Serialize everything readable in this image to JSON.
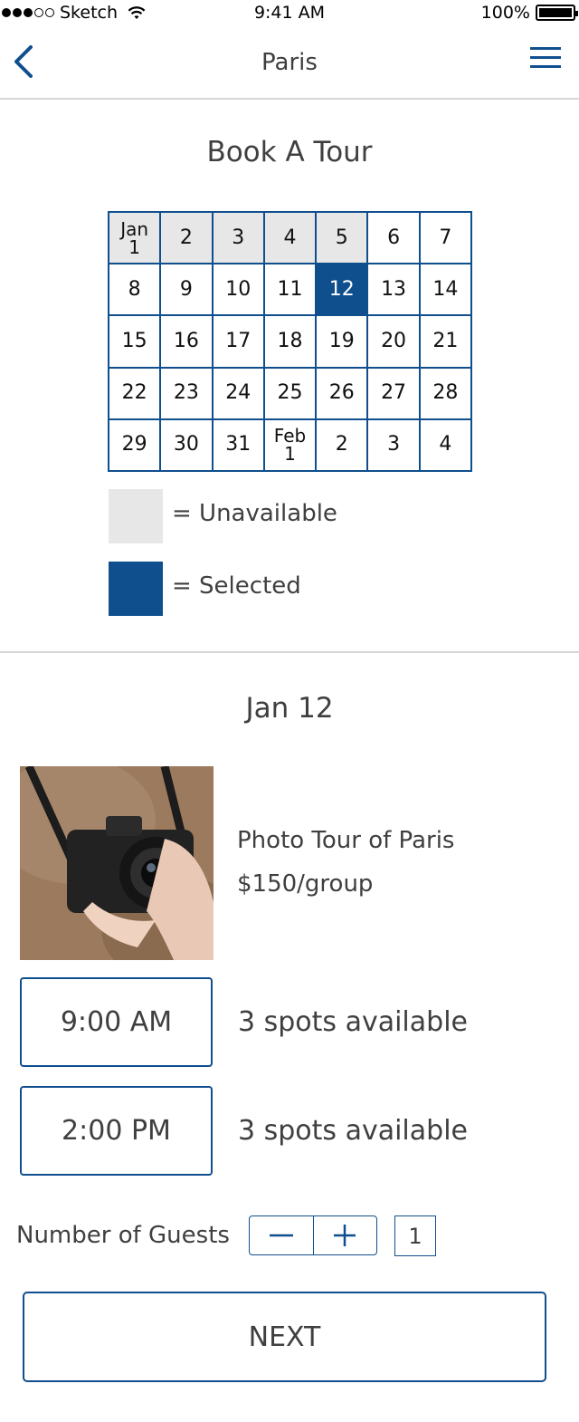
{
  "status_bar": {
    "carrier": "Sketch",
    "time": "9:41 AM",
    "battery": "100%",
    "signal_bars": 3
  },
  "nav": {
    "title": "Paris",
    "back_icon": "chevron-left-icon",
    "menu_icon": "hamburger-menu-icon"
  },
  "booking": {
    "heading": "Book A Tour"
  },
  "calendar": {
    "selected": "12",
    "rows": [
      [
        {
          "label": "Jan\n1",
          "state": "unavailable"
        },
        {
          "label": "2",
          "state": "unavailable"
        },
        {
          "label": "3",
          "state": "unavailable"
        },
        {
          "label": "4",
          "state": "unavailable"
        },
        {
          "label": "5",
          "state": "unavailable"
        },
        {
          "label": "6",
          "state": "available"
        },
        {
          "label": "7",
          "state": "available"
        }
      ],
      [
        {
          "label": "8",
          "state": "available"
        },
        {
          "label": "9",
          "state": "available"
        },
        {
          "label": "10",
          "state": "available"
        },
        {
          "label": "11",
          "state": "available"
        },
        {
          "label": "12",
          "state": "selected"
        },
        {
          "label": "13",
          "state": "available"
        },
        {
          "label": "14",
          "state": "available"
        }
      ],
      [
        {
          "label": "15",
          "state": "available"
        },
        {
          "label": "16",
          "state": "available"
        },
        {
          "label": "17",
          "state": "available"
        },
        {
          "label": "18",
          "state": "available"
        },
        {
          "label": "19",
          "state": "available"
        },
        {
          "label": "20",
          "state": "available"
        },
        {
          "label": "21",
          "state": "available"
        }
      ],
      [
        {
          "label": "22",
          "state": "available"
        },
        {
          "label": "23",
          "state": "available"
        },
        {
          "label": "24",
          "state": "available"
        },
        {
          "label": "25",
          "state": "available"
        },
        {
          "label": "26",
          "state": "available"
        },
        {
          "label": "27",
          "state": "available"
        },
        {
          "label": "28",
          "state": "available"
        }
      ],
      [
        {
          "label": "29",
          "state": "available"
        },
        {
          "label": "30",
          "state": "available"
        },
        {
          "label": "31",
          "state": "available"
        },
        {
          "label": "Feb\n1",
          "state": "available"
        },
        {
          "label": "2",
          "state": "available"
        },
        {
          "label": "3",
          "state": "available"
        },
        {
          "label": "4",
          "state": "available"
        }
      ]
    ]
  },
  "legend": {
    "unavailable": "= Unavailable",
    "selected": "= Selected"
  },
  "colors": {
    "accent": "#104f8e",
    "unavailable": "#e7e7e7",
    "text": "#3f3f3f",
    "divider": "#d6d6d6"
  },
  "day": {
    "date_label": "Jan 12"
  },
  "tour": {
    "name": "Photo Tour of Paris",
    "price": "$150/group",
    "image": "camera-photo"
  },
  "slots": [
    {
      "time": "9:00 AM",
      "availability": "3 spots available"
    },
    {
      "time": "2:00 PM",
      "availability": "3 spots available"
    }
  ],
  "guests": {
    "label": "Number of Guests",
    "decrement_icon": "minus-icon",
    "increment_icon": "plus-icon",
    "count": "1"
  },
  "actions": {
    "next": "NEXT"
  }
}
